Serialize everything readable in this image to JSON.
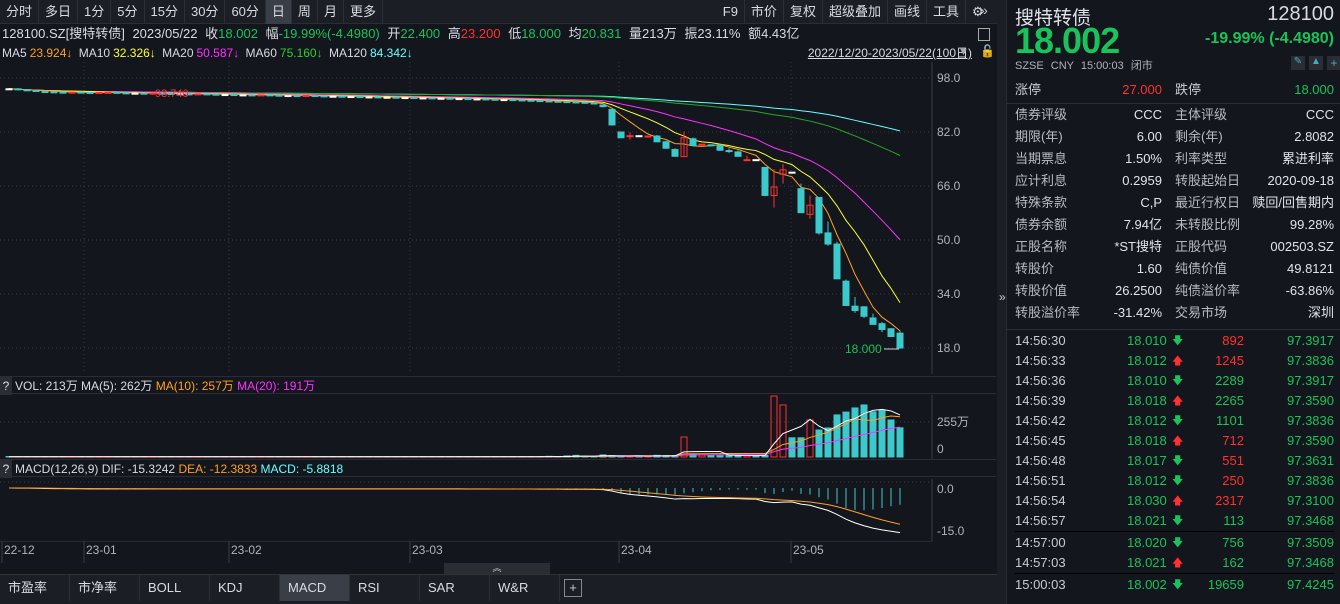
{
  "toolbar": {
    "periods": [
      "分时",
      "多日",
      "1分",
      "5分",
      "15分",
      "30分",
      "60分",
      "日",
      "周",
      "月",
      "更多"
    ],
    "active": "日",
    "right": [
      "F9",
      "市价",
      "复权",
      "超级叠加",
      "画线",
      "工具"
    ]
  },
  "info": {
    "code": "128100.SZ[搜特转债]",
    "date": "2023/05/22",
    "close_label": "收",
    "close": "18.002",
    "chg_label": "幅",
    "chg": "-19.99%(-4.4980)",
    "open_label": "开",
    "open": "22.400",
    "high_label": "高",
    "high": "23.200",
    "low_label": "低",
    "low": "18.000",
    "avg_label": "均",
    "avg": "20.831",
    "vol": "量213万",
    "amp": "振23.11%",
    "amt": "额4.43亿"
  },
  "ma": {
    "ma5_label": "MA5",
    "ma5": "23.924↓",
    "ma10_label": "MA10",
    "ma10": "32.326↓",
    "ma20_label": "MA20",
    "ma20": "50.587↓",
    "ma60_label": "MA60",
    "ma60": "75.160↓",
    "ma120_label": "MA120",
    "ma120": "84.342↓",
    "range": "2022/12/20-2023/05/22(100日)"
  },
  "chart_data": {
    "type": "candlestick",
    "price_ticks": [
      "98.0",
      "82.0",
      "66.0",
      "50.0",
      "34.0",
      "18.0"
    ],
    "ylim": [
      18,
      98
    ],
    "high_label": "93.740",
    "low_label": "18.000",
    "early_closes": [
      94.8,
      94.5,
      94.3,
      94.0,
      93.9,
      93.8,
      93.7,
      93.8,
      93.7,
      93.6,
      93.7,
      93.74,
      93.6,
      93.5,
      93.5,
      93.4,
      93.5,
      93.4,
      93.3,
      93.3,
      93.2,
      93.3,
      93.2,
      93.1,
      93.1,
      93.0,
      93.0,
      92.9,
      93.0,
      92.9,
      92.8,
      92.8,
      92.7,
      92.8,
      92.7,
      92.6,
      92.6,
      92.5,
      92.5,
      92.4,
      92.4,
      92.3,
      92.3,
      92.2,
      92.2,
      92.1,
      92.1,
      92.0,
      92.0,
      91.9,
      91.9,
      91.8,
      91.8,
      91.7,
      91.6,
      91.6,
      91.5,
      91.4,
      91.3,
      91.2,
      91.1,
      91.0,
      90.9,
      90.8,
      90.6,
      90.3
    ],
    "late_ohlc": [
      [
        90,
        89.5,
        90.2,
        89.3
      ],
      [
        88.7,
        84.1,
        88.7,
        83.9
      ],
      [
        82,
        80.3,
        82,
        80.2
      ],
      [
        80.6,
        80.9,
        81.9,
        79.7
      ],
      [
        80.9,
        80.9,
        81,
        80.8
      ],
      [
        80.7,
        80.8,
        80.9,
        80.6
      ],
      [
        80.8,
        79.1,
        81.1,
        79
      ],
      [
        79.1,
        77.2,
        79.4,
        77
      ],
      [
        76.8,
        74.8,
        77.2,
        74.7
      ],
      [
        74.7,
        80.3,
        82.1,
        74.7
      ],
      [
        80,
        78,
        80.4,
        77.9
      ],
      [
        78.3,
        78.4,
        78.5,
        78.2
      ],
      [
        78.2,
        78.1,
        78.2,
        78
      ],
      [
        78.1,
        76.6,
        78.3,
        76.4
      ],
      [
        76.5,
        76.4,
        77.1,
        75.8
      ],
      [
        76.1,
        74.8,
        76.5,
        74.7
      ],
      [
        73.7,
        73.8,
        75,
        73.7
      ],
      [
        73.8,
        73.8,
        73.8,
        73.8
      ],
      [
        71.5,
        63.2,
        71.6,
        63
      ],
      [
        63.2,
        65.7,
        71,
        59.6
      ],
      [
        69.5,
        70.8,
        72.5,
        66.7
      ],
      [
        70.1,
        70.1,
        70.1,
        70.1
      ],
      [
        65.2,
        58.1,
        66.7,
        58
      ],
      [
        57.6,
        60.3,
        63.2,
        56.3
      ],
      [
        62.6,
        52.1,
        62.6,
        51.6
      ],
      [
        52.1,
        48.8,
        55.5,
        48.3
      ],
      [
        48.8,
        38.5,
        49.5,
        38.4
      ],
      [
        37.8,
        30.6,
        38.3,
        30.5
      ],
      [
        30.4,
        29.1,
        33.1,
        28.4
      ],
      [
        30.2,
        27.4,
        30.4,
        26.9
      ],
      [
        26.9,
        25,
        28.2,
        25
      ],
      [
        25.2,
        23.5,
        25.7,
        22.7
      ],
      [
        23.7,
        21.4,
        23.9,
        21.4
      ],
      [
        22.4,
        18,
        23.2,
        18
      ]
    ],
    "x_ticks": [
      "22-12",
      "23-01",
      "23-02",
      "23-03",
      "23-04",
      "23-05"
    ],
    "volume": {
      "title": "VOL: 213万",
      "ma5": "MA(5): 262万",
      "ma10": "MA(10): 257万",
      "ma20": "MA(20): 191万",
      "tick_top": "255万",
      "tick_zero": "0",
      "late_values_wan": [
        5,
        3,
        8,
        12,
        6,
        4,
        15,
        10,
        8,
        6,
        5,
        8,
        12,
        10,
        9,
        146,
        20,
        15,
        12,
        10,
        14,
        9,
        10,
        8,
        12,
        445,
        380,
        140,
        140,
        270,
        197,
        212,
        307,
        328,
        358,
        380,
        330,
        343,
        270,
        213
      ]
    },
    "macd": {
      "title": "MACD(12,26,9)",
      "dif": "DIF: -15.3242",
      "dea": "DEA: -12.3833",
      "macd": "MACD: -5.8818",
      "tick_zero": "0.0",
      "tick_low": "-15.0"
    }
  },
  "tabs": [
    "市盈率",
    "市净率",
    "BOLL",
    "KDJ",
    "MACD",
    "RSI",
    "SAR",
    "W&R"
  ],
  "active_tab": "MACD",
  "quote": {
    "name": "搜特转债",
    "code": "128100",
    "price": "18.002",
    "change": "-19.99% (-4.4980)",
    "market": "SZSE",
    "currency": "CNY",
    "time": "15:00:03",
    "status": "闭市",
    "limit_up_label": "涨停",
    "limit_up": "27.000",
    "limit_down_label": "跌停",
    "limit_down": "18.000"
  },
  "stats": [
    [
      "债券评级",
      "CCC",
      "主体评级",
      "CCC"
    ],
    [
      "期限(年)",
      "6.00",
      "剩余(年)",
      "2.8082"
    ],
    [
      "当期票息",
      "1.50%",
      "利率类型",
      "累进利率"
    ],
    [
      "应计利息",
      "0.2959",
      "转股起始日",
      "2020-09-18"
    ],
    [
      "特殊条款",
      "C,P",
      "最近行权日",
      "赎回/回售期内"
    ],
    [
      "债券余额",
      "7.94亿",
      "未转股比例",
      "99.28%"
    ],
    [
      "正股名称",
      "*ST搜特",
      "正股代码",
      "002503.SZ"
    ],
    [
      "转股价",
      "1.60",
      "纯债价值",
      "49.8121"
    ],
    [
      "转股价值",
      "26.2500",
      "纯债溢价率",
      "-63.86%"
    ],
    [
      "转股溢价率",
      "-31.42%",
      "交易市场",
      "深圳"
    ]
  ],
  "ticks": [
    [
      "14:56:30",
      "18.010",
      "down",
      "892",
      "r",
      "97.3917"
    ],
    [
      "14:56:33",
      "18.012",
      "up",
      "1245",
      "r",
      "97.3836"
    ],
    [
      "14:56:36",
      "18.010",
      "down",
      "2289",
      "g",
      "97.3917"
    ],
    [
      "14:56:39",
      "18.018",
      "up",
      "2265",
      "g",
      "97.3590"
    ],
    [
      "14:56:42",
      "18.012",
      "down",
      "1101",
      "g",
      "97.3836"
    ],
    [
      "14:56:45",
      "18.018",
      "up",
      "712",
      "r",
      "97.3590"
    ],
    [
      "14:56:48",
      "18.017",
      "down",
      "551",
      "r",
      "97.3631"
    ],
    [
      "14:56:51",
      "18.012",
      "down",
      "250",
      "r",
      "97.3836"
    ],
    [
      "14:56:54",
      "18.030",
      "up",
      "2317",
      "r",
      "97.3100"
    ],
    [
      "14:56:57",
      "18.021",
      "down",
      "113",
      "g",
      "97.3468"
    ],
    [
      "14:57:00",
      "18.020",
      "down",
      "756",
      "g",
      "97.3509"
    ],
    [
      "14:57:03",
      "18.021",
      "up",
      "162",
      "g",
      "97.3468"
    ],
    [
      "15:00:03",
      "18.002",
      "down",
      "19659",
      "g",
      "97.4245"
    ]
  ],
  "colors": {
    "up": "#ff3030",
    "down": "#3cc9cc",
    "green": "#19c25a",
    "bg": "#13161c"
  }
}
